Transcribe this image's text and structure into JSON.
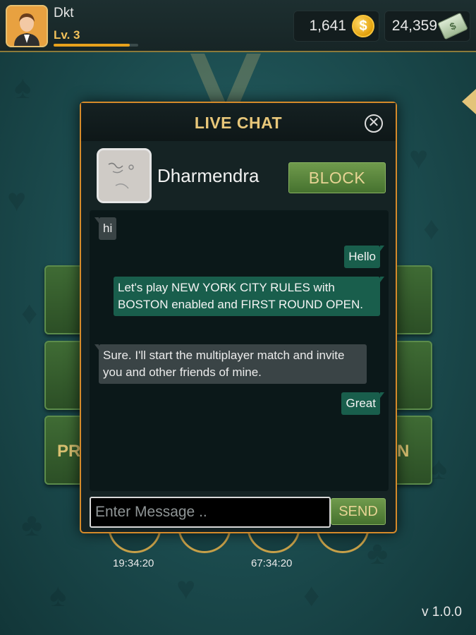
{
  "player": {
    "name": "Dkt",
    "level": "Lv. 3",
    "xp_fraction": 0.9
  },
  "currency": {
    "coins": "1,641",
    "coin_symbol": "$",
    "cash": "24,359",
    "cash_symbol": "$"
  },
  "background": {
    "left_button_partial_text": "PR",
    "right_button_partial_text": "N",
    "timers": [
      "19:34:20",
      "67:34:20"
    ],
    "version": "v 1.0.0"
  },
  "chat": {
    "title": "LIVE CHAT",
    "close_symbol": "✕",
    "friend_name": "Dharmendra",
    "block_label": "BLOCK",
    "messages": [
      {
        "from": "friend",
        "text": "hi"
      },
      {
        "from": "me",
        "text": "Hello"
      },
      {
        "from": "me",
        "text": "Let's play NEW YORK CITY RULES with BOSTON enabled and FIRST ROUND OPEN."
      },
      {
        "from": "friend",
        "text": "Sure. I'll start the multiplayer match and invite you and other friends of mine."
      },
      {
        "from": "me",
        "text": "Great"
      }
    ],
    "input_placeholder": "Enter Message ..",
    "input_value": "",
    "send_label": "SEND"
  },
  "colors": {
    "accent_gold": "#e8c77a",
    "modal_border": "#d58a2a",
    "outgoing_bubble": "#195e4c",
    "incoming_bubble": "#3a4446",
    "button_green": "#46722f"
  }
}
